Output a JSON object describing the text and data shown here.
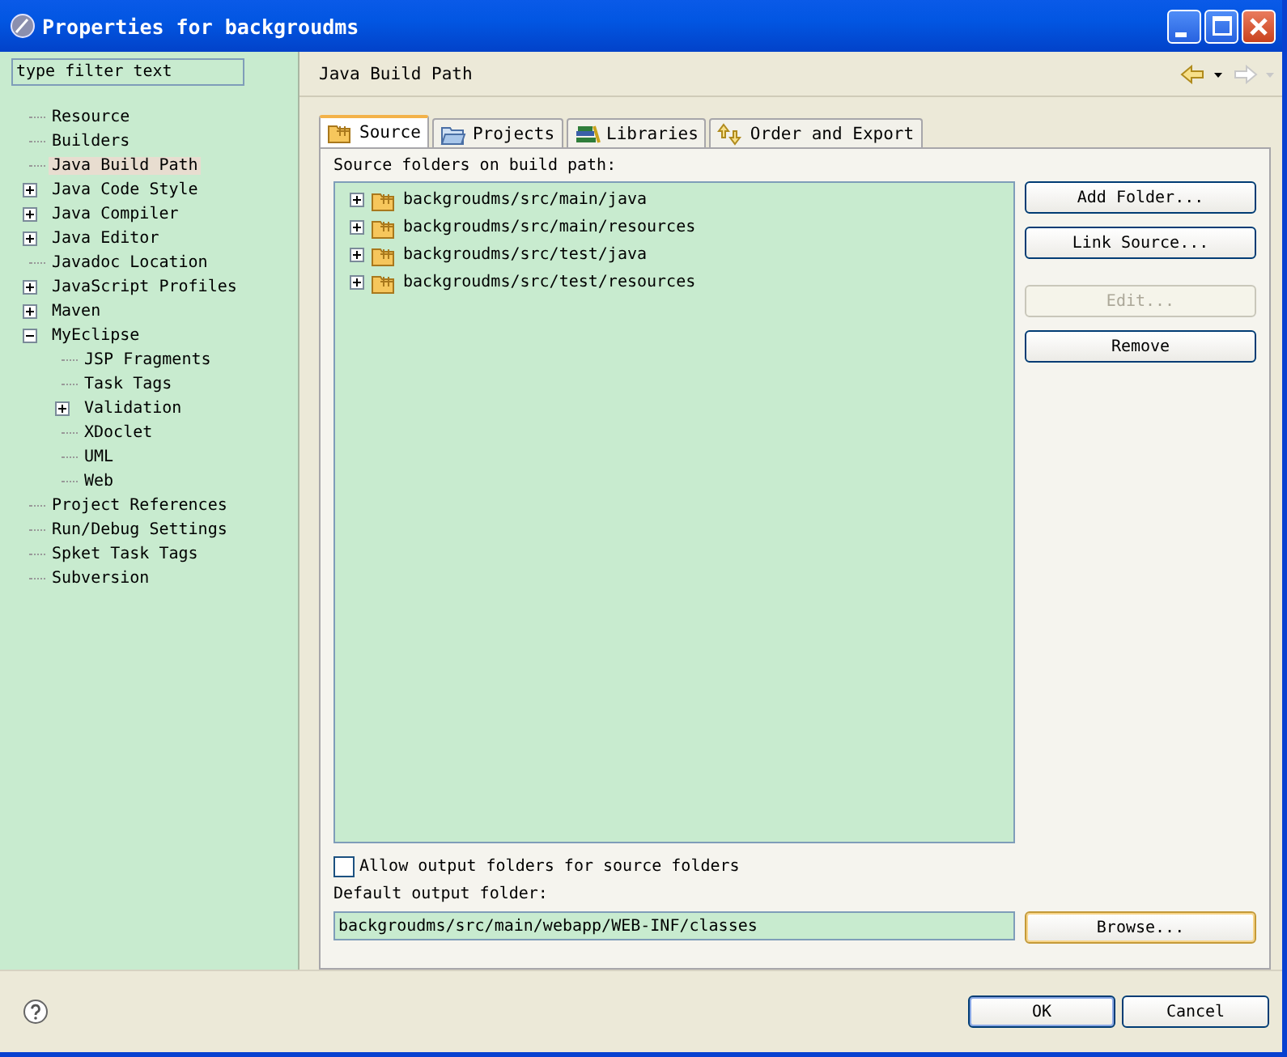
{
  "window": {
    "title": "Properties for backgroudms"
  },
  "filter": {
    "placeholder": "type filter text"
  },
  "sidebar": {
    "items": [
      {
        "label": "Resource",
        "selected": false
      },
      {
        "label": "Builders",
        "selected": false
      },
      {
        "label": "Java Build Path",
        "selected": true
      },
      {
        "label": "Java Code Style",
        "selected": false,
        "expanded": false
      },
      {
        "label": "Java Compiler",
        "selected": false,
        "expanded": false
      },
      {
        "label": "Java Editor",
        "selected": false,
        "expanded": false
      },
      {
        "label": "Javadoc Location",
        "selected": false
      },
      {
        "label": "JavaScript Profiles",
        "selected": false,
        "expanded": false
      },
      {
        "label": "Maven",
        "selected": false,
        "expanded": false
      },
      {
        "label": "MyEclipse",
        "selected": false,
        "expanded": true,
        "children": [
          {
            "label": "JSP Fragments",
            "selected": false
          },
          {
            "label": "Task Tags",
            "selected": false
          },
          {
            "label": "Validation",
            "selected": false,
            "expanded": false
          },
          {
            "label": "XDoclet",
            "selected": false
          },
          {
            "label": "UML",
            "selected": false
          },
          {
            "label": "Web",
            "selected": false
          }
        ]
      },
      {
        "label": "Project References",
        "selected": false
      },
      {
        "label": "Run/Debug Settings",
        "selected": false
      },
      {
        "label": "Spket Task Tags",
        "selected": false
      },
      {
        "label": "Subversion",
        "selected": false
      }
    ]
  },
  "page": {
    "title": "Java Build Path"
  },
  "tabs": [
    {
      "label": "Source",
      "kind": "source",
      "selected": true
    },
    {
      "label": "Projects",
      "kind": "projects",
      "selected": false
    },
    {
      "label": "Libraries",
      "kind": "libraries",
      "selected": false
    },
    {
      "label": "Order and Export",
      "kind": "order",
      "selected": false
    }
  ],
  "source_list": {
    "label": "Source folders on build path:",
    "items": [
      {
        "label": "backgroudms/src/main/java",
        "expanded": false
      },
      {
        "label": "backgroudms/src/main/resources",
        "expanded": false
      },
      {
        "label": "backgroudms/src/test/java",
        "expanded": false
      },
      {
        "label": "backgroudms/src/test/resources",
        "expanded": false
      }
    ]
  },
  "buttons": [
    {
      "label": "Add Folder...",
      "disabled": false
    },
    {
      "label": "Link Source...",
      "disabled": false
    },
    {
      "label": "Edit...",
      "disabled": true
    },
    {
      "label": "Remove",
      "disabled": false
    }
  ],
  "allow_output": {
    "label": "Allow output folders for source folders",
    "checked": false
  },
  "output": {
    "label": "Default output folder:",
    "value": "backgroudms/src/main/webapp/WEB-INF/classes"
  },
  "browse_button": {
    "label": "Browse..."
  },
  "dialog_buttons": [
    {
      "label": "OK"
    },
    {
      "label": "Cancel"
    }
  ]
}
